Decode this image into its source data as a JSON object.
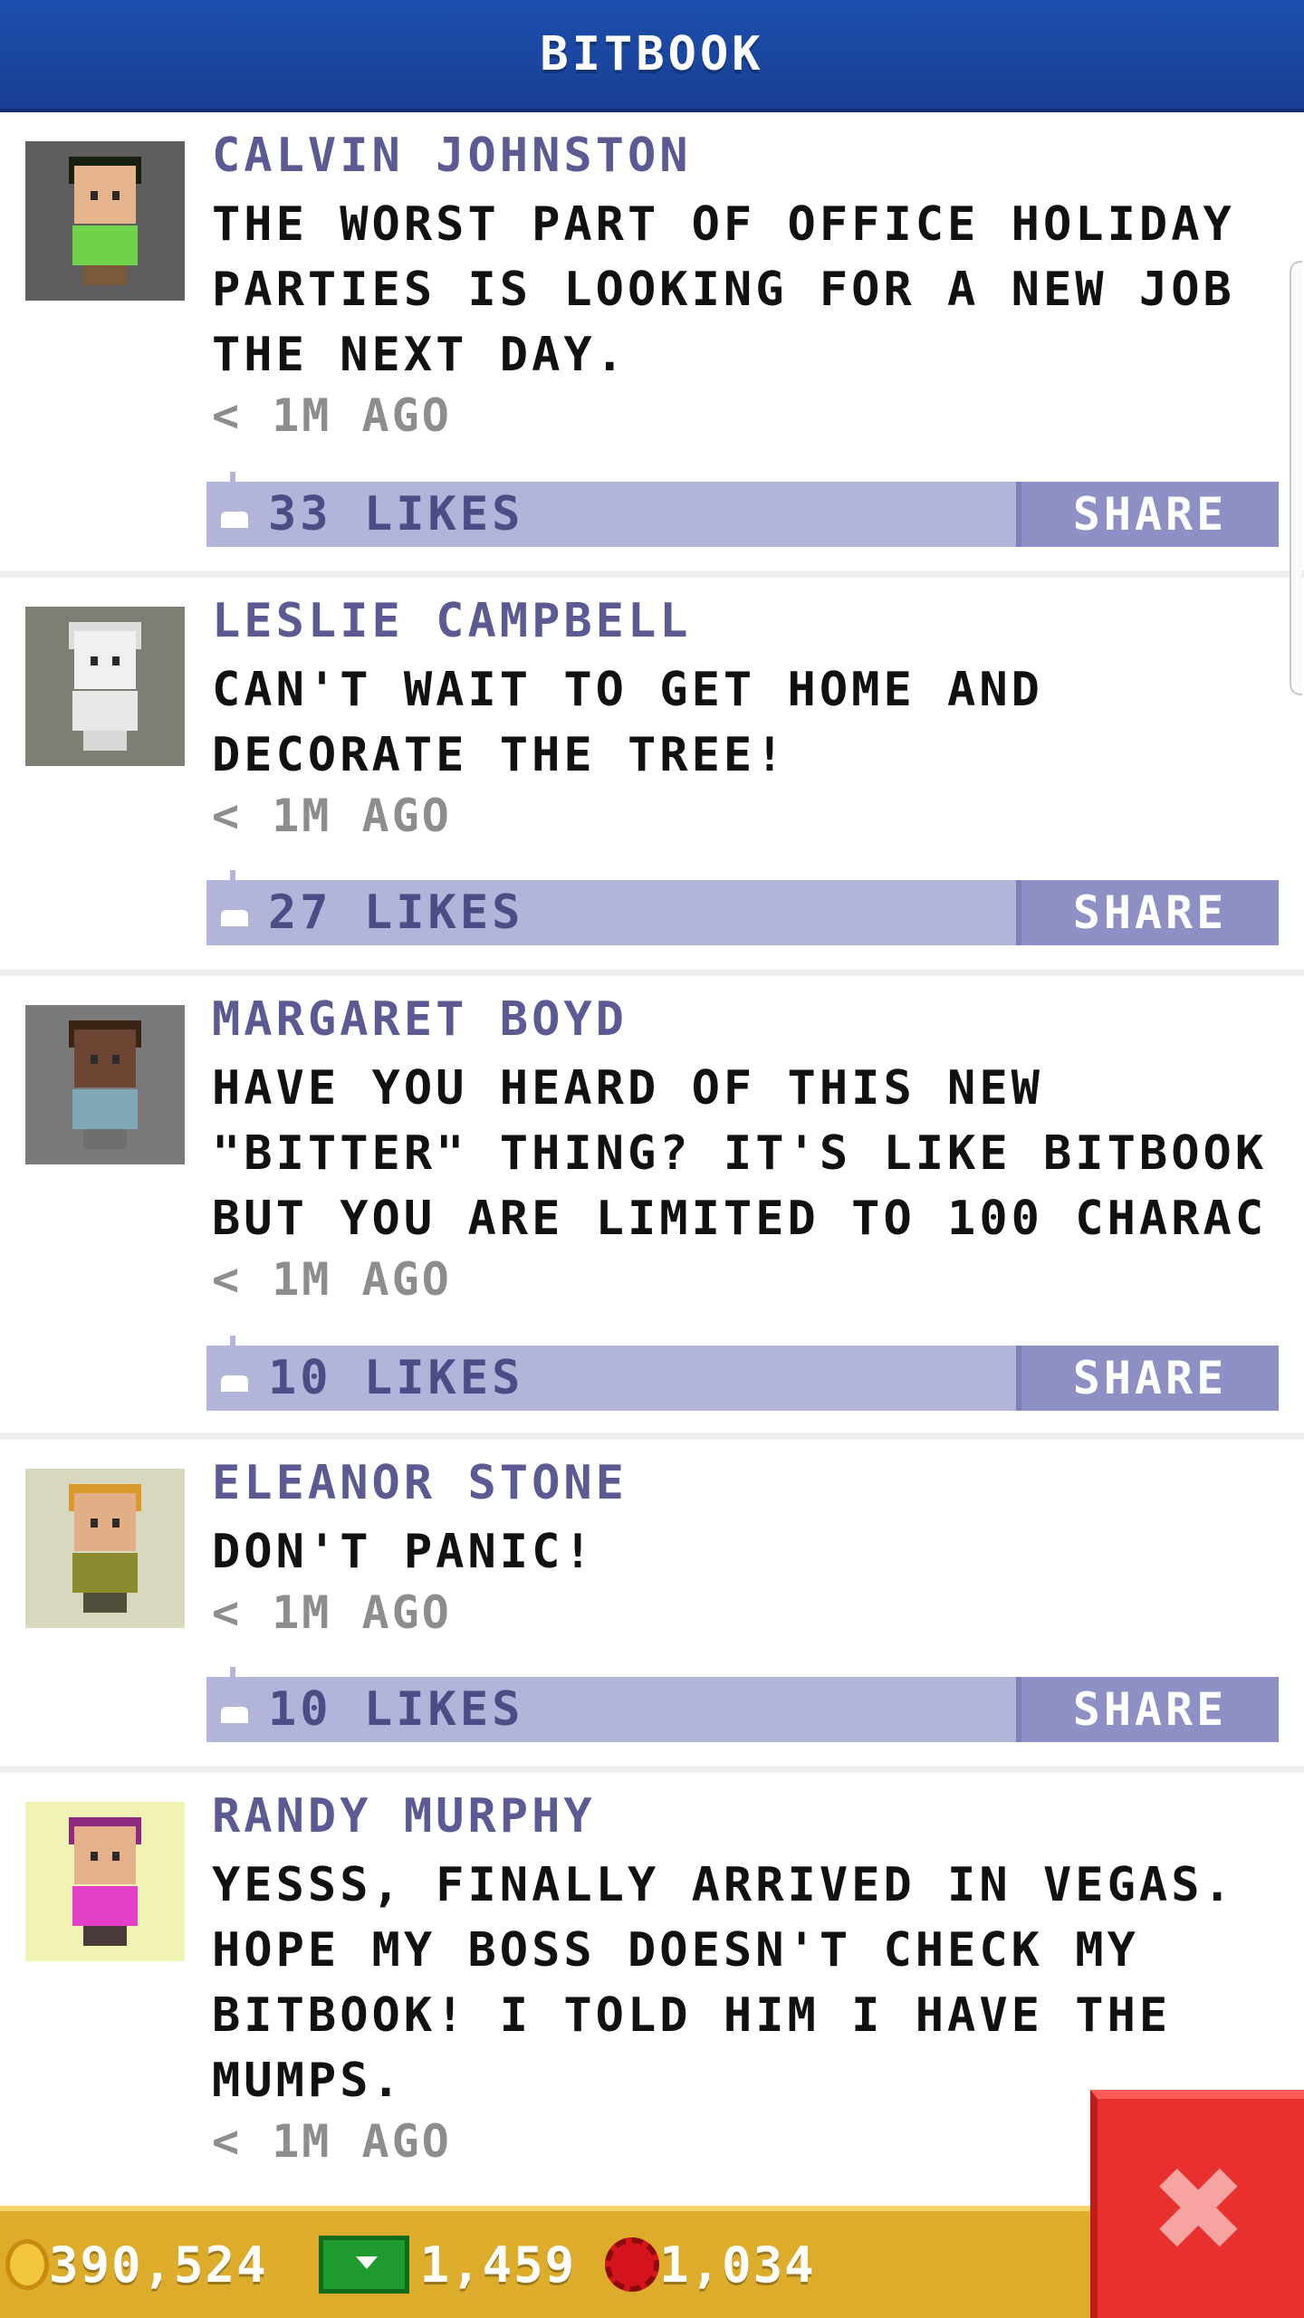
{
  "header": {
    "title": "BITBOOK"
  },
  "posts": [
    {
      "author": "CALVIN JOHNSTON",
      "message": "THE WORST PART OF OFFICE HOLIDAY PARTIES IS LOOKING FOR A NEW JOB THE NEXT DAY.",
      "time": "< 1M AGO",
      "likes": "33 LIKES",
      "share": "SHARE",
      "avatar_bg": "#5e5e5e"
    },
    {
      "author": "LESLIE CAMPBELL",
      "message": "CAN'T WAIT TO GET HOME AND DECORATE THE TREE!",
      "time": "< 1M AGO",
      "likes": "27 LIKES",
      "share": "SHARE",
      "avatar_bg": "#7e7e74"
    },
    {
      "author": "MARGARET BOYD",
      "message": "HAVE YOU HEARD OF THIS NEW \"BITTER\" THING? IT'S LIKE BITBOOK BUT YOU ARE LIMITED TO 100 CHARAC",
      "time": "< 1M AGO",
      "likes": "10 LIKES",
      "share": "SHARE",
      "avatar_bg": "#7a7a7a"
    },
    {
      "author": "ELEANOR STONE",
      "message": "DON'T PANIC!",
      "time": "< 1M AGO",
      "likes": "10 LIKES",
      "share": "SHARE",
      "avatar_bg": "#d7d8bd"
    },
    {
      "author": "RANDY MURPHY",
      "message": "YESSS, FINALLY ARRIVED IN VEGAS. HOPE MY BOSS DOESN'T CHECK MY BITBOOK! I TOLD HIM I HAVE THE MUMPS.",
      "time": "< 1M AGO",
      "avatar_bg": "#f1f3b5"
    }
  ],
  "bottom_bar": {
    "coins": "390,524",
    "cash": "1,459",
    "chips": "1,034"
  },
  "close_label": "✖",
  "colors": {
    "header": "#1d4fae",
    "author": "#5c5a92",
    "like_bar": "#b3b4d9",
    "share_button": "#8e8fc4",
    "bottom_bar": "#dcac2a",
    "close_button": "#e8302f"
  },
  "icons": {
    "likes": "thumbs-up-icon",
    "coins": "coin-icon",
    "cash": "cash-icon",
    "chips": "poker-chip-icon",
    "close": "close-icon"
  }
}
